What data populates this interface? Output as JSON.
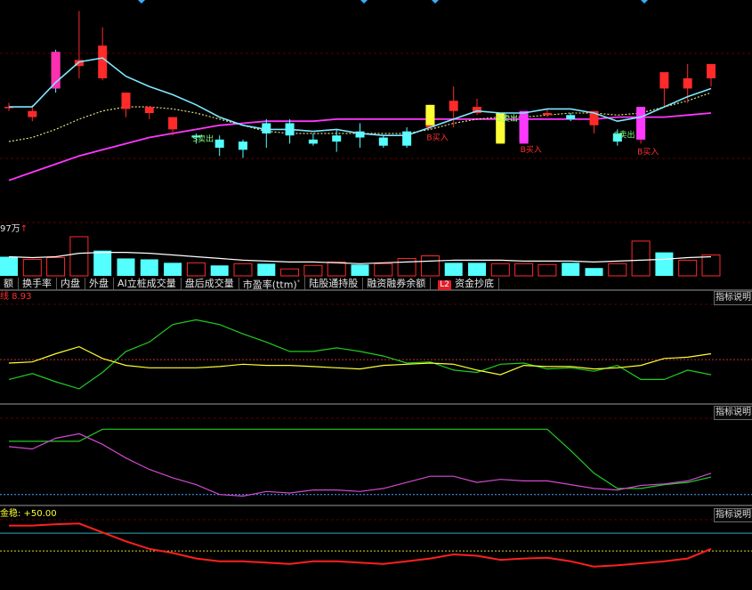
{
  "colors": {
    "up": "#ff2a2a",
    "down": "#54ffff",
    "ma_short": "#7fe8ff",
    "ma_mid": "#f5f08a",
    "ma_long": "#ff38ff",
    "buy_label": "#ff3030",
    "sell_label": "#7fff7f",
    "grid": "#5a0000",
    "yellow": "#ffff33",
    "green": "#22cc22",
    "magenta": "#d24ad2",
    "red": "#ff2020",
    "cyan_line": "#2aaabb"
  },
  "tabs": [
    {
      "label": "额",
      "active": false
    },
    {
      "label": "换手率",
      "active": false
    },
    {
      "label": "内盘",
      "active": false
    },
    {
      "label": "外盘",
      "active": false
    },
    {
      "label": "AI立桩成交量",
      "active": false
    },
    {
      "label": "盘后成交量",
      "active": false
    },
    {
      "label": "市盈率(ttm)",
      "active": false
    },
    {
      "label": "陆股通持股",
      "active": false
    },
    {
      "label": "融资融券余额",
      "active": false
    },
    {
      "label": "资金抄底",
      "active": true,
      "badge": "L2"
    }
  ],
  "panels": {
    "volume_label": "97万",
    "volume_arrow": "↑",
    "ind1_label": "线 8.93",
    "ind3_label": "金稳: +50.00",
    "info_button": "指标说明"
  },
  "chart_data": [
    {
      "type": "candlestick",
      "title": "",
      "candles": [
        {
          "o": 47.2,
          "h": 47.4,
          "l": 47.0,
          "c": 47.2
        },
        {
          "o": 46.7,
          "h": 47.3,
          "l": 46.5,
          "c": 47.0
        },
        {
          "o": 49.8,
          "h": 50.0,
          "l": 47.9,
          "c": 48.1
        },
        {
          "o": 49.2,
          "h": 51.9,
          "l": 48.6,
          "c": 49.5
        },
        {
          "o": 48.6,
          "h": 51.1,
          "l": 48.5,
          "c": 50.2
        },
        {
          "o": 47.1,
          "h": 47.4,
          "l": 46.7,
          "c": 47.9
        },
        {
          "o": 46.9,
          "h": 47.2,
          "l": 46.6,
          "c": 47.2
        },
        {
          "o": 46.1,
          "h": 46.7,
          "l": 45.8,
          "c": 46.7
        },
        {
          "o": 45.8,
          "h": 45.9,
          "l": 45.4,
          "c": 45.7
        },
        {
          "o": 45.6,
          "h": 45.8,
          "l": 44.8,
          "c": 45.2
        },
        {
          "o": 45.5,
          "h": 45.6,
          "l": 44.7,
          "c": 45.1
        },
        {
          "o": 46.4,
          "h": 46.6,
          "l": 45.2,
          "c": 45.9
        },
        {
          "o": 46.4,
          "h": 46.6,
          "l": 45.4,
          "c": 45.8
        },
        {
          "o": 45.6,
          "h": 45.9,
          "l": 45.3,
          "c": 45.4
        },
        {
          "o": 45.8,
          "h": 46.1,
          "l": 45.0,
          "c": 45.5
        },
        {
          "o": 46.0,
          "h": 46.4,
          "l": 45.2,
          "c": 45.7
        },
        {
          "o": 45.7,
          "h": 45.8,
          "l": 45.2,
          "c": 45.3
        },
        {
          "o": 46.0,
          "h": 46.2,
          "l": 45.2,
          "c": 45.3
        },
        {
          "o": 46.2,
          "h": 47.3,
          "l": 46.1,
          "c": 47.0
        },
        {
          "o": 47.0,
          "h": 48.2,
          "l": 46.2,
          "c": 47.5
        },
        {
          "o": 46.9,
          "h": 47.6,
          "l": 46.8,
          "c": 47.2
        },
        {
          "o": 46.7,
          "h": 46.9,
          "l": 45.4,
          "c": 45.5
        },
        {
          "o": 46.8,
          "h": 46.9,
          "l": 45.5,
          "c": 45.5
        },
        {
          "o": 46.8,
          "h": 47.1,
          "l": 46.7,
          "c": 46.9
        },
        {
          "o": 46.8,
          "h": 46.9,
          "l": 46.5,
          "c": 46.6
        },
        {
          "o": 46.3,
          "h": 46.8,
          "l": 45.9,
          "c": 47.0
        },
        {
          "o": 45.9,
          "h": 46.1,
          "l": 45.3,
          "c": 45.5
        },
        {
          "o": 45.6,
          "h": 46.1,
          "l": 45.4,
          "c": 46.9
        },
        {
          "o": 48.1,
          "h": 48.6,
          "l": 47.2,
          "c": 48.9
        },
        {
          "o": 48.1,
          "h": 49.3,
          "l": 47.4,
          "c": 48.6
        },
        {
          "o": 48.6,
          "h": 49.0,
          "l": 48.2,
          "c": 49.3
        }
      ],
      "special_bars": [
        {
          "index": 2,
          "color": "#ff2fb0",
          "top": 49.9,
          "bottom": 48.1
        },
        {
          "index": 18,
          "color": "#ffff33",
          "top": 47.3,
          "bottom": 46.3
        },
        {
          "index": 21,
          "color": "#ffff33",
          "top": 46.9,
          "bottom": 45.4
        },
        {
          "index": 22,
          "color": "#ff38ff",
          "top": 47.0,
          "bottom": 45.4
        },
        {
          "index": 27,
          "color": "#ff38ff",
          "top": 47.2,
          "bottom": 45.6
        }
      ],
      "signals": [
        {
          "index": 8,
          "text": "S卖出",
          "kind": "sell"
        },
        {
          "index": 21,
          "text": "S卖出",
          "kind": "sell"
        },
        {
          "index": 26,
          "text": "S卖出",
          "kind": "sell"
        },
        {
          "index": 18,
          "text": "B买入",
          "kind": "buy"
        },
        {
          "index": 22,
          "text": "B买入",
          "kind": "buy"
        },
        {
          "index": 27,
          "text": "B买入",
          "kind": "buy"
        }
      ],
      "ma_short": [
        47.2,
        47.2,
        48.4,
        49.4,
        49.6,
        48.7,
        48.2,
        47.8,
        47.3,
        46.7,
        46.3,
        46.1,
        46.1,
        46.0,
        46.1,
        45.9,
        45.8,
        45.8,
        46.2,
        46.6,
        47.0,
        46.9,
        46.9,
        47.1,
        47.1,
        46.9,
        46.5,
        46.7,
        47.2,
        47.7,
        48.1
      ],
      "ma_mid": [
        45.5,
        45.7,
        46.1,
        46.6,
        47.0,
        47.2,
        47.2,
        47.1,
        46.9,
        46.6,
        46.3,
        46.0,
        45.9,
        45.9,
        45.9,
        45.9,
        45.9,
        45.9,
        46.1,
        46.4,
        46.6,
        46.7,
        46.7,
        46.8,
        46.9,
        46.9,
        46.8,
        46.9,
        47.2,
        47.5,
        47.9
      ],
      "ma_long": [
        43.6,
        44.0,
        44.4,
        44.8,
        45.1,
        45.4,
        45.7,
        45.9,
        46.1,
        46.3,
        46.4,
        46.5,
        46.5,
        46.5,
        46.6,
        46.6,
        46.6,
        46.6,
        46.6,
        46.6,
        46.6,
        46.6,
        46.6,
        46.6,
        46.6,
        46.6,
        46.7,
        46.7,
        46.7,
        46.8,
        46.9
      ],
      "volume": [
        {
          "v": 22,
          "dir": "down"
        },
        {
          "v": 19,
          "dir": "up"
        },
        {
          "v": 21,
          "dir": "up"
        },
        {
          "v": 45,
          "dir": "up"
        },
        {
          "v": 29,
          "dir": "down"
        },
        {
          "v": 20,
          "dir": "down"
        },
        {
          "v": 19,
          "dir": "down"
        },
        {
          "v": 15,
          "dir": "down"
        },
        {
          "v": 15,
          "dir": "up"
        },
        {
          "v": 12,
          "dir": "down"
        },
        {
          "v": 14,
          "dir": "up"
        },
        {
          "v": 14,
          "dir": "down"
        },
        {
          "v": 8,
          "dir": "up"
        },
        {
          "v": 12,
          "dir": "up"
        },
        {
          "v": 16,
          "dir": "up"
        },
        {
          "v": 13,
          "dir": "down"
        },
        {
          "v": 14,
          "dir": "up"
        },
        {
          "v": 20,
          "dir": "up"
        },
        {
          "v": 23,
          "dir": "up"
        },
        {
          "v": 15,
          "dir": "down"
        },
        {
          "v": 15,
          "dir": "down"
        },
        {
          "v": 14,
          "dir": "up"
        },
        {
          "v": 14,
          "dir": "up"
        },
        {
          "v": 13,
          "dir": "up"
        },
        {
          "v": 15,
          "dir": "down"
        },
        {
          "v": 9,
          "dir": "down"
        },
        {
          "v": 14,
          "dir": "up"
        },
        {
          "v": 40,
          "dir": "up"
        },
        {
          "v": 27,
          "dir": "down"
        },
        {
          "v": 18,
          "dir": "up"
        },
        {
          "v": 24,
          "dir": "up"
        }
      ],
      "volume_ma": [
        22,
        21,
        22,
        26,
        27,
        27,
        26,
        24,
        22,
        20,
        18,
        17,
        16,
        16,
        15,
        14,
        15,
        16,
        17,
        18,
        18,
        18,
        17,
        17,
        17,
        16,
        17,
        18,
        19,
        21,
        22
      ],
      "ind1_yellow": [
        52,
        53,
        60,
        66,
        56,
        50,
        48,
        48,
        48,
        49,
        51,
        50,
        50,
        49,
        48,
        47,
        50,
        51,
        52,
        51,
        46,
        42,
        50,
        49,
        49,
        47,
        48,
        50,
        56,
        57,
        60
      ],
      "ind1_green": [
        38,
        43,
        36,
        30,
        44,
        62,
        70,
        85,
        89,
        85,
        77,
        70,
        62,
        62,
        65,
        62,
        58,
        52,
        53,
        46,
        44,
        51,
        52,
        47,
        48,
        45,
        50,
        38,
        38,
        46,
        42
      ],
      "ind1_red_dash": 55,
      "ind2_green": [
        82,
        82,
        82,
        82,
        98,
        98,
        98,
        98,
        98,
        98,
        98,
        98,
        98,
        98,
        98,
        98,
        98,
        98,
        98,
        98,
        98,
        98,
        98,
        98,
        70,
        40,
        20,
        20,
        25,
        28,
        35
      ],
      "ind2_magenta": [
        75,
        72,
        86,
        92,
        78,
        60,
        45,
        34,
        25,
        12,
        10,
        16,
        14,
        18,
        18,
        16,
        20,
        28,
        36,
        36,
        28,
        32,
        30,
        30,
        25,
        20,
        18,
        24,
        26,
        30,
        40
      ],
      "ind2_blue_dash": 12,
      "ind3_red": [
        94,
        94,
        96,
        97,
        84,
        71,
        60,
        54,
        46,
        42,
        42,
        40,
        38,
        42,
        42,
        40,
        38,
        42,
        46,
        52,
        50,
        44,
        46,
        47,
        42,
        34,
        36,
        39,
        42,
        46,
        60
      ],
      "ind3_cyan": 83,
      "ind3_yellow_dash": 57
    }
  ]
}
